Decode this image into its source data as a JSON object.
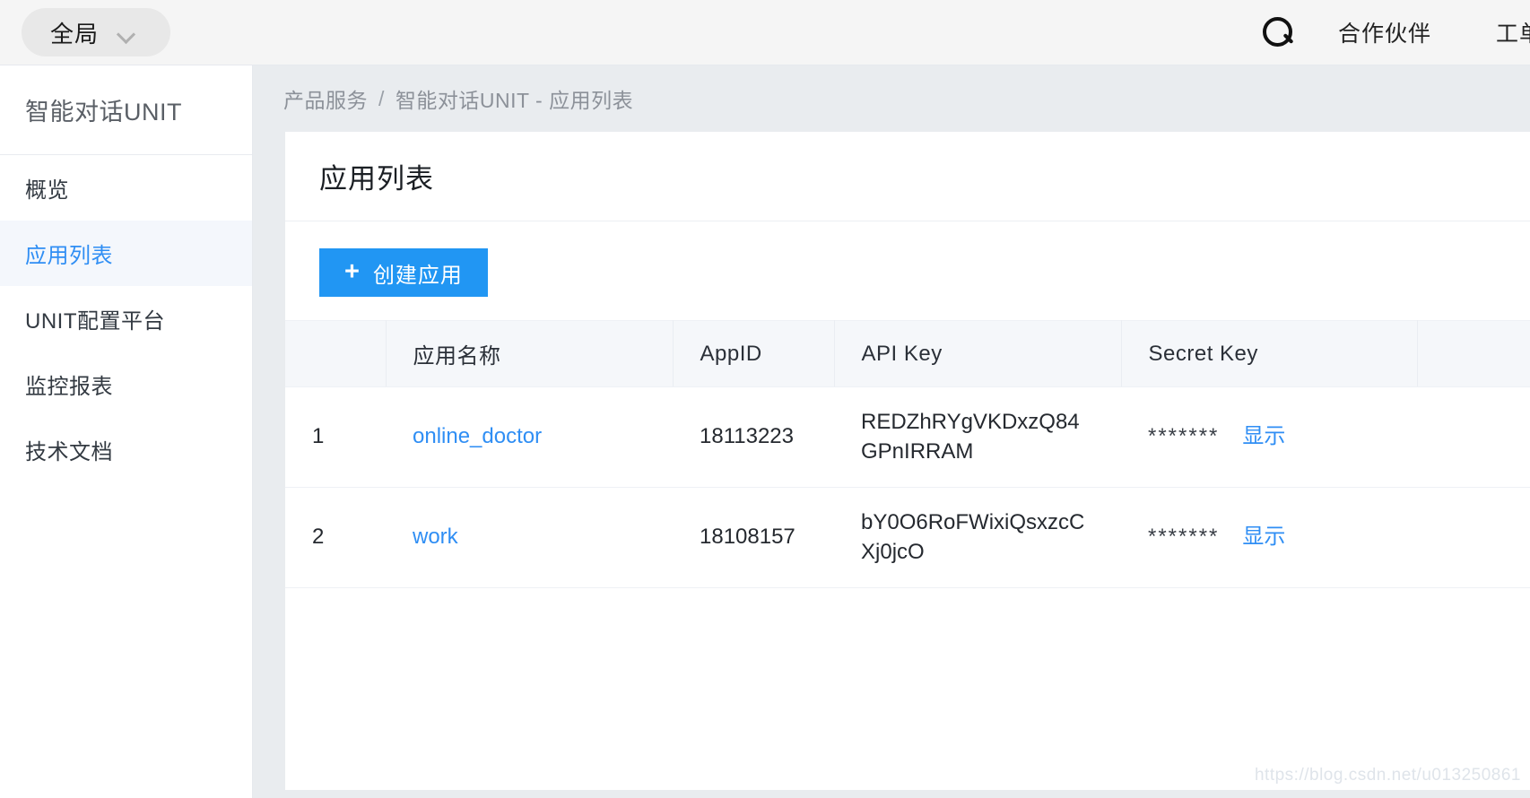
{
  "topbar": {
    "scope_selector": "全局",
    "scope_caret": "chevron-down-icon",
    "search_icon": "search-icon",
    "links": [
      {
        "label": "合作伙伴"
      },
      {
        "label": "工单"
      }
    ]
  },
  "sidebar": {
    "title": "智能对话UNIT",
    "items": [
      {
        "label": "概览",
        "active": false
      },
      {
        "label": "应用列表",
        "active": true
      },
      {
        "label": "UNIT配置平台",
        "active": false
      },
      {
        "label": "监控报表",
        "active": false
      },
      {
        "label": "技术文档",
        "active": false
      }
    ]
  },
  "breadcrumb": {
    "root": "产品服务",
    "separator": "/",
    "current": "智能对话UNIT - 应用列表"
  },
  "card": {
    "title": "应用列表",
    "create_button": {
      "icon": "plus-icon",
      "plus": "+",
      "label": "创建应用"
    }
  },
  "table": {
    "columns": {
      "index": "",
      "name": "应用名称",
      "appid": "AppID",
      "apikey": "API Key",
      "secret": "Secret Key",
      "extra": ""
    },
    "rows": [
      {
        "index": "1",
        "name": "online_doctor",
        "appid": "18113223",
        "apikey": "REDZhRYgVKDxzQ84GPnIRRAM",
        "secret_mask": "*******",
        "secret_action": "显示"
      },
      {
        "index": "2",
        "name": "work",
        "appid": "18108157",
        "apikey": "bY0O6RoFWixiQsxzcCXj0jcO",
        "secret_mask": "*******",
        "secret_action": "显示"
      }
    ]
  },
  "watermark": "https://blog.csdn.net/u013250861",
  "colors": {
    "accent": "#2f8ef4",
    "button": "#2196f3",
    "page_bg": "#e9ecef",
    "topbar_bg": "#f5f5f5",
    "header_row_bg": "#f5f7fa",
    "active_item_bg": "#f4f7fc"
  }
}
